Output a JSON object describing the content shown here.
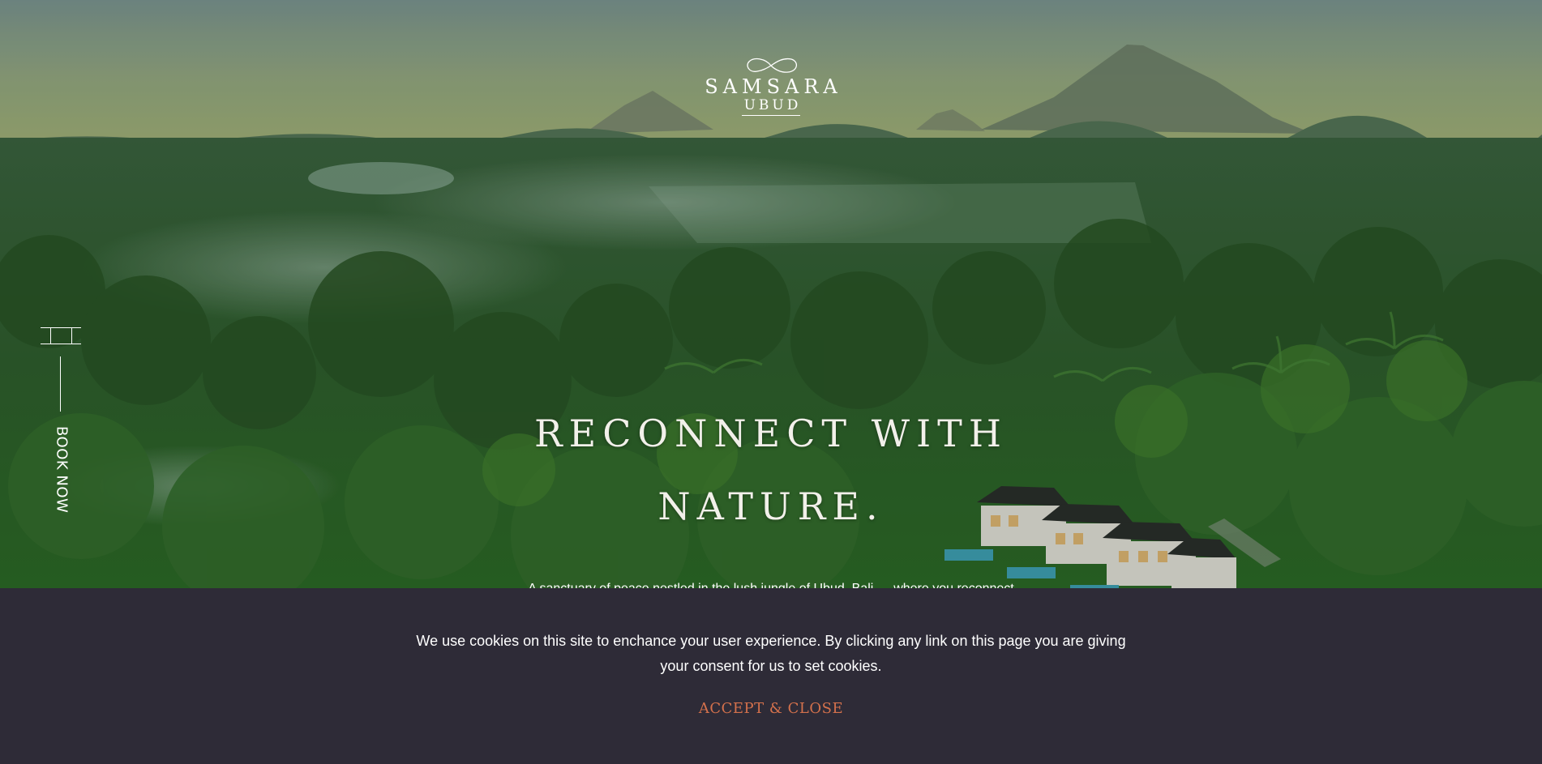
{
  "brand": {
    "name": "SAMSARA",
    "location": "UBUD",
    "logo_icon": "infinity-icon"
  },
  "nav": {
    "menu_icon": "menu-icon",
    "book_now_label": "BOOK NOW"
  },
  "hero": {
    "headline_line1": "RECONNECT WITH",
    "headline_line2": "NATURE.",
    "subline": "A sanctuary of peace nestled in the lush jungle of Ubud, Bali — where you reconnect"
  },
  "cookie_bar": {
    "message": "We use cookies on this site to enchance your user experience. By clicking any link on this page you are giving your consent for us to set cookies.",
    "accept_label": "ACCEPT & CLOSE"
  },
  "colors": {
    "cookie_background": "#2e2b37",
    "accept_accent": "#d4714c",
    "text_light": "#ffffff"
  }
}
